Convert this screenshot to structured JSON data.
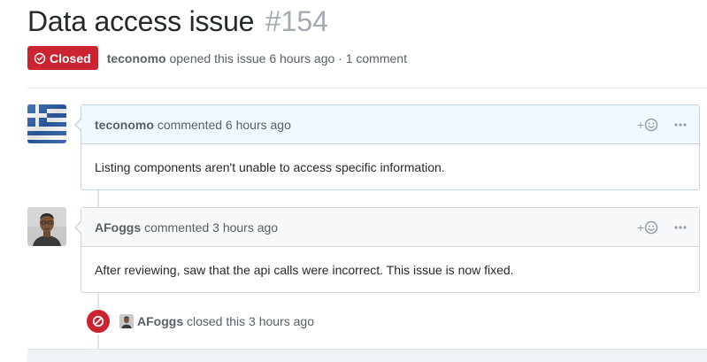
{
  "issue": {
    "title": "Data access issue",
    "number": "#154",
    "state_label": "Closed",
    "state_color": "#cb2431",
    "author": "teconomo",
    "meta_text": "opened this issue 6 hours ago · 1 comment"
  },
  "comments": [
    {
      "author": "teconomo",
      "time": "commented 6 hours ago",
      "body": "Listing components aren't unable to access specific information.",
      "avatar": "greek-flag-avatar"
    },
    {
      "author": "AFoggs",
      "time": "commented 3 hours ago",
      "body": "After reviewing, saw that the api calls were incorrect. This issue is now fixed.",
      "avatar": "person-photo-avatar"
    }
  ],
  "event": {
    "author": "AFoggs",
    "text": "closed this 3 hours ago",
    "icon": "circle-slash-icon"
  },
  "colors": {
    "closed_red": "#cb2431",
    "muted_text": "#586069",
    "header_blue": "#f1f8ff",
    "header_gray": "#f6f8fa"
  }
}
